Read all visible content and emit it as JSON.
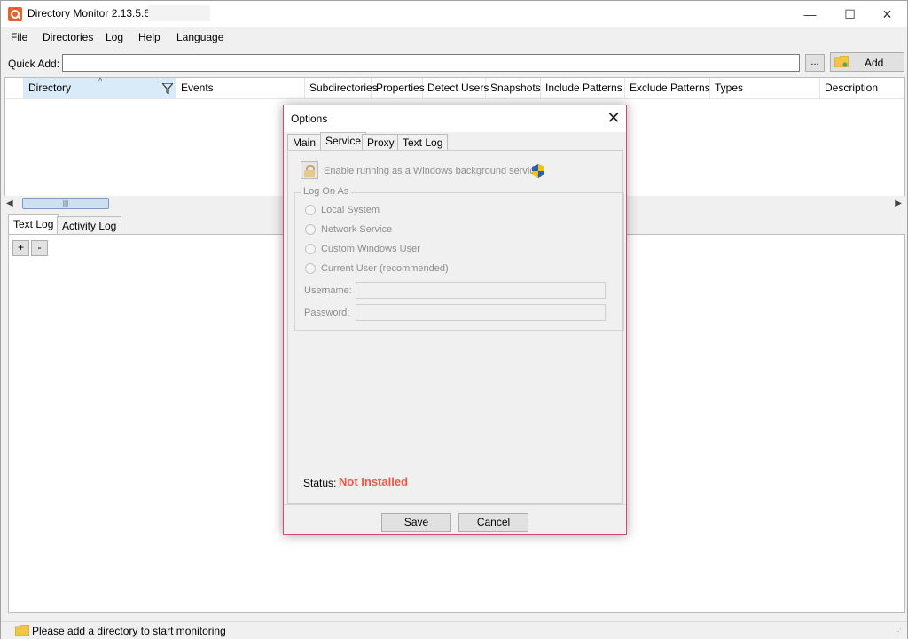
{
  "window": {
    "title": "Directory Monitor 2.13.5.6 -",
    "minimize_glyph": "—",
    "maximize_glyph": "☐",
    "close_glyph": "✕"
  },
  "menu": [
    "File",
    "Directories",
    "Log",
    "Help",
    "Language"
  ],
  "quick_add": {
    "label": "Quick Add:",
    "value": "",
    "browse_label": "...",
    "add_label": "Add"
  },
  "grid": {
    "columns": [
      "Directory",
      "Events",
      "Subdirectories",
      "Properties",
      "Detect Users",
      "Snapshots",
      "Include Patterns",
      "Exclude Patterns",
      "Types",
      "Description"
    ],
    "sort_indicator": "^",
    "rows": []
  },
  "scrollbar": {
    "left_glyph": "◀",
    "right_glyph": "▶",
    "thumb_grip": "|||"
  },
  "bottom_tabs": [
    "Text Log",
    "Activity Log"
  ],
  "log_buttons": {
    "plus": "+",
    "minus": "-"
  },
  "statusbar": {
    "text": "Please add a directory to start monitoring",
    "grip": "⋰"
  },
  "dialog": {
    "title": "Options",
    "close_glyph": "✕",
    "tabs": [
      "Main",
      "Service",
      "Proxy",
      "Text Log"
    ],
    "active_tab": "Service",
    "enable_service_label": "Enable running as a Windows background service",
    "logon_group_label": "Log On As",
    "logon_options": [
      "Local System",
      "Network Service",
      "Custom Windows User",
      "Current User (recommended)"
    ],
    "username_label": "Username:",
    "username_value": "",
    "password_label": "Password:",
    "password_value": "",
    "status_label": "Status:",
    "status_value": "Not Installed",
    "save_label": "Save",
    "cancel_label": "Cancel"
  },
  "colors": {
    "accent_selected_column": "#d9ebf9",
    "status_not_installed": "#ea5a4a",
    "dialog_border": "#d3487a",
    "app_icon": "#e8602c"
  },
  "icons": [
    "app-icon",
    "folder-icon",
    "filter-icon",
    "lock-icon",
    "shield-icon"
  ]
}
